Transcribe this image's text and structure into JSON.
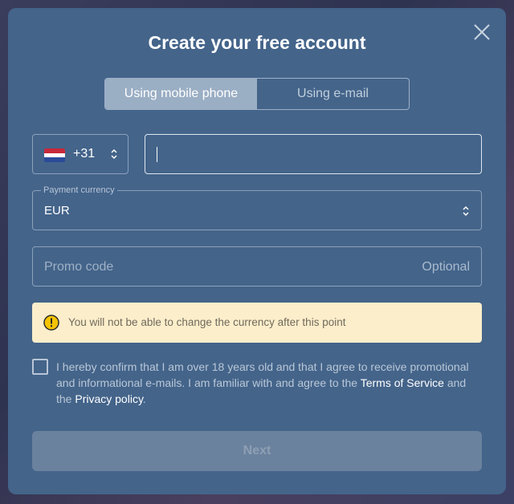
{
  "modal": {
    "title": "Create your free account",
    "close_icon": "close-icon"
  },
  "tabs": [
    {
      "label": "Using mobile phone",
      "active": true
    },
    {
      "label": "Using e-mail",
      "active": false
    }
  ],
  "phone": {
    "country_flag": "netherlands-flag-icon",
    "dial_code": "+31",
    "value": ""
  },
  "currency": {
    "label": "Payment currency",
    "value": "EUR"
  },
  "promo": {
    "placeholder": "Promo code",
    "optional_label": "Optional"
  },
  "warning": {
    "icon": "exclamation-icon",
    "text": "You will not be able to change the currency after this point"
  },
  "consent": {
    "text_part1": "I hereby confirm that I am over 18 years old and that I agree to receive promotional and informational e-mails. I am familiar with and agree to the ",
    "terms_link": "Terms of Service",
    "text_part2": " and the ",
    "privacy_link": "Privacy policy",
    "text_part3": ".",
    "checked": false
  },
  "next_button": {
    "label": "Next",
    "disabled": true
  },
  "colors": {
    "modal_bg": "#44648a",
    "warning_bg": "#fdeecb",
    "warning_icon": "#f5c400",
    "tab_active_bg": "#9aaec4",
    "button_disabled_bg": "#6b829e"
  }
}
